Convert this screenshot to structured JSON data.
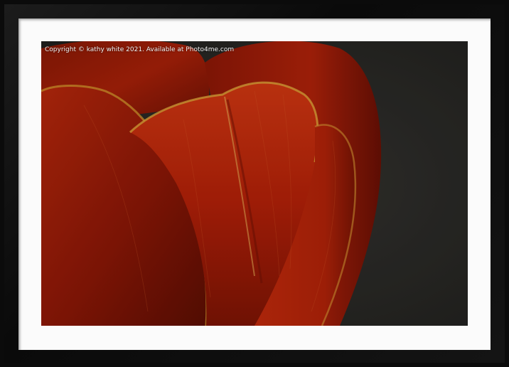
{
  "copyright": "Copyright © kathy white 2021. Available at Photo4me.com",
  "subject": "red-tulip-petals-closeup",
  "colors": {
    "frame": "#0b0b0b",
    "mount": "#fbfbfb",
    "background": "#2b2b29",
    "petal_red": "#c2250c",
    "petal_edge": "#d8a030"
  }
}
